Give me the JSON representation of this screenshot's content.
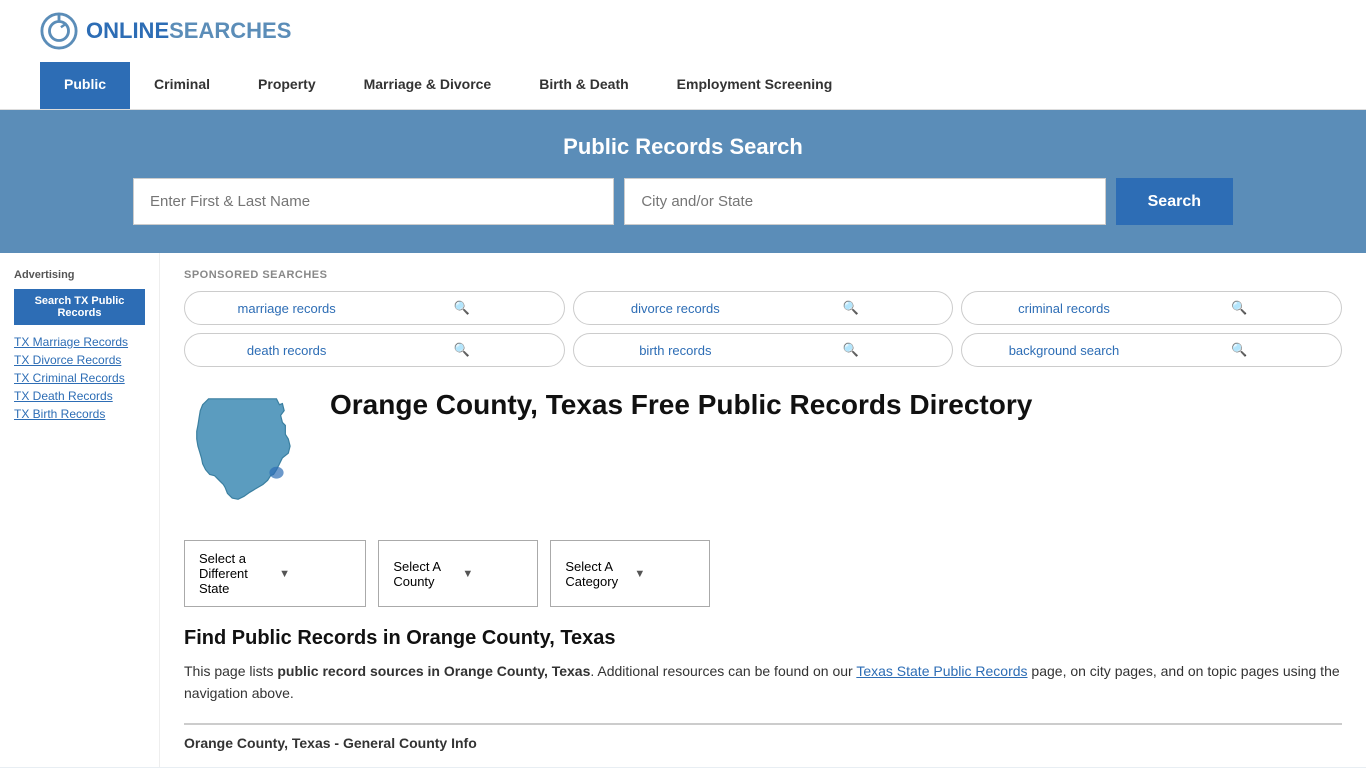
{
  "header": {
    "logo_text_1": "ONLINE",
    "logo_text_2": "SEARCHES"
  },
  "nav": {
    "items": [
      {
        "label": "Public",
        "active": true
      },
      {
        "label": "Criminal",
        "active": false
      },
      {
        "label": "Property",
        "active": false
      },
      {
        "label": "Marriage & Divorce",
        "active": false
      },
      {
        "label": "Birth & Death",
        "active": false
      },
      {
        "label": "Employment Screening",
        "active": false
      }
    ]
  },
  "search_band": {
    "title": "Public Records Search",
    "name_placeholder": "Enter First & Last Name",
    "city_placeholder": "City and/or State",
    "button_label": "Search"
  },
  "sponsored": {
    "label": "SPONSORED SEARCHES",
    "items": [
      {
        "text": "marriage records"
      },
      {
        "text": "divorce records"
      },
      {
        "text": "criminal records"
      },
      {
        "text": "death records"
      },
      {
        "text": "birth records"
      },
      {
        "text": "background search"
      }
    ]
  },
  "page": {
    "heading": "Orange County, Texas Free Public Records Directory",
    "dropdowns": {
      "state": "Select a Different State",
      "county": "Select A County",
      "category": "Select A Category"
    },
    "find_heading": "Find Public Records in Orange County, Texas",
    "find_text_1": "This page lists ",
    "find_text_bold": "public record sources in Orange County, Texas",
    "find_text_2": ". Additional resources can be found on our ",
    "find_link": "Texas State Public Records",
    "find_text_3": " page, on city pages, and on topic pages using the navigation above.",
    "county_info_title": "Orange County, Texas - General County Info"
  },
  "sidebar": {
    "ad_label": "Advertising",
    "ad_btn": "Search TX Public Records",
    "links": [
      "TX Marriage Records",
      "TX Divorce Records",
      "TX Criminal Records",
      "TX Death Records",
      "TX Birth Records"
    ]
  }
}
